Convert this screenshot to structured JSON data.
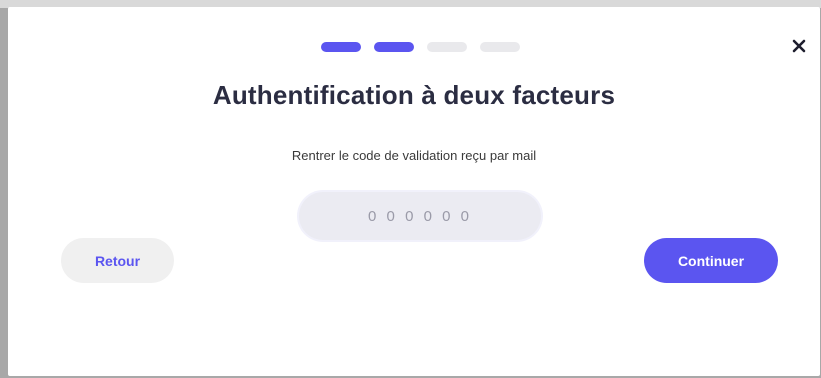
{
  "dialog": {
    "title": "Authentification à deux facteurs",
    "instruction": "Rentrer le code de validation reçu par mail",
    "code_placeholder": "0 0 0 0 0 0",
    "code_value": "",
    "back_label": "Retour",
    "continue_label": "Continuer",
    "close_icon": "close-icon",
    "steps": {
      "total": 4,
      "completed": 2
    }
  },
  "colors": {
    "accent": "#5b55f0",
    "step_active": "#5b55f0",
    "step_inactive": "#e9e9ec",
    "title": "#2b2d42",
    "input_bg": "#ebebf2",
    "back_button_bg": "#f0f0f0"
  }
}
